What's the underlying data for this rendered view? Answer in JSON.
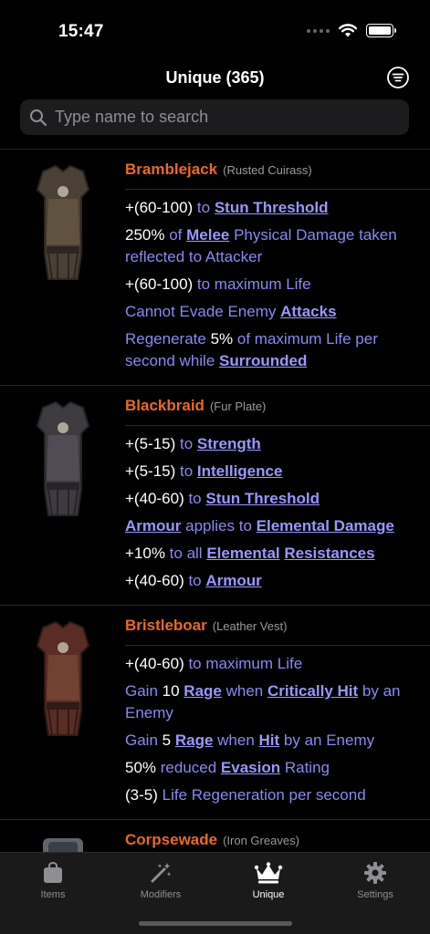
{
  "status": {
    "time": "15:47"
  },
  "header": {
    "title": "Unique (365)"
  },
  "search": {
    "placeholder": "Type name to search"
  },
  "items": [
    {
      "name": "Bramblejack",
      "base": "(Rusted Cuirass)",
      "image": "body-armour-icon",
      "mods": [
        [
          {
            "t": "w",
            "s": "+(60-100)"
          },
          {
            "t": "v",
            "s": " to "
          },
          {
            "t": "k",
            "s": "Stun Threshold"
          }
        ],
        [
          {
            "t": "w",
            "s": "250%"
          },
          {
            "t": "v",
            "s": " of "
          },
          {
            "t": "k",
            "s": "Melee"
          },
          {
            "t": "v",
            "s": " Physical Damage taken reflected to Attacker"
          }
        ],
        [
          {
            "t": "w",
            "s": "+(60-100)"
          },
          {
            "t": "v",
            "s": " to maximum Life"
          }
        ],
        [
          {
            "t": "v",
            "s": "Cannot Evade Enemy "
          },
          {
            "t": "k",
            "s": "Attacks"
          }
        ],
        [
          {
            "t": "v",
            "s": "Regenerate "
          },
          {
            "t": "w",
            "s": "5%"
          },
          {
            "t": "v",
            "s": " of maximum Life per second while "
          },
          {
            "t": "k",
            "s": "Surrounded"
          }
        ]
      ]
    },
    {
      "name": "Blackbraid",
      "base": "(Fur Plate)",
      "image": "body-armour-icon",
      "mods": [
        [
          {
            "t": "w",
            "s": "+(5-15)"
          },
          {
            "t": "v",
            "s": " to "
          },
          {
            "t": "k",
            "s": "Strength"
          }
        ],
        [
          {
            "t": "w",
            "s": "+(5-15)"
          },
          {
            "t": "v",
            "s": " to "
          },
          {
            "t": "k",
            "s": "Intelligence"
          }
        ],
        [
          {
            "t": "w",
            "s": "+(40-60)"
          },
          {
            "t": "v",
            "s": " to "
          },
          {
            "t": "k",
            "s": "Stun Threshold"
          }
        ],
        [
          {
            "t": "k",
            "s": "Armour"
          },
          {
            "t": "v",
            "s": " applies to "
          },
          {
            "t": "k",
            "s": "Elemental Damage"
          }
        ],
        [
          {
            "t": "w",
            "s": "+10%"
          },
          {
            "t": "v",
            "s": " to all "
          },
          {
            "t": "k",
            "s": "Elemental"
          },
          {
            "t": "v",
            "s": " "
          },
          {
            "t": "k",
            "s": "Resistances"
          }
        ],
        [
          {
            "t": "w",
            "s": "+(40-60)"
          },
          {
            "t": "v",
            "s": " to "
          },
          {
            "t": "k",
            "s": "Armour"
          }
        ]
      ]
    },
    {
      "name": "Bristleboar",
      "base": "(Leather Vest)",
      "image": "body-armour-icon",
      "mods": [
        [
          {
            "t": "w",
            "s": "+(40-60)"
          },
          {
            "t": "v",
            "s": " to maximum Life"
          }
        ],
        [
          {
            "t": "v",
            "s": "Gain "
          },
          {
            "t": "w",
            "s": "10"
          },
          {
            "t": "v",
            "s": " "
          },
          {
            "t": "k",
            "s": "Rage"
          },
          {
            "t": "v",
            "s": " when "
          },
          {
            "t": "k",
            "s": "Critically Hit"
          },
          {
            "t": "v",
            "s": " by an Enemy"
          }
        ],
        [
          {
            "t": "v",
            "s": "Gain "
          },
          {
            "t": "w",
            "s": "5"
          },
          {
            "t": "v",
            "s": " "
          },
          {
            "t": "k",
            "s": "Rage"
          },
          {
            "t": "v",
            "s": " when "
          },
          {
            "t": "k",
            "s": "Hit"
          },
          {
            "t": "v",
            "s": " by an Enemy"
          }
        ],
        [
          {
            "t": "w",
            "s": "50%"
          },
          {
            "t": "v",
            "s": " reduced "
          },
          {
            "t": "k",
            "s": "Evasion"
          },
          {
            "t": "v",
            "s": " Rating"
          }
        ],
        [
          {
            "t": "w",
            "s": "(3-5)"
          },
          {
            "t": "v",
            "s": " Life Regeneration per second"
          }
        ]
      ]
    },
    {
      "name": "Corpsewade",
      "base": "(Iron Greaves)",
      "image": "boots-icon",
      "mods": []
    }
  ],
  "tabs": [
    {
      "label": "Items",
      "icon": "bag-icon",
      "active": false
    },
    {
      "label": "Modifiers",
      "icon": "magic-wand-icon",
      "active": false
    },
    {
      "label": "Unique",
      "icon": "crown-icon",
      "active": true
    },
    {
      "label": "Settings",
      "icon": "gear-icon",
      "active": false
    }
  ]
}
